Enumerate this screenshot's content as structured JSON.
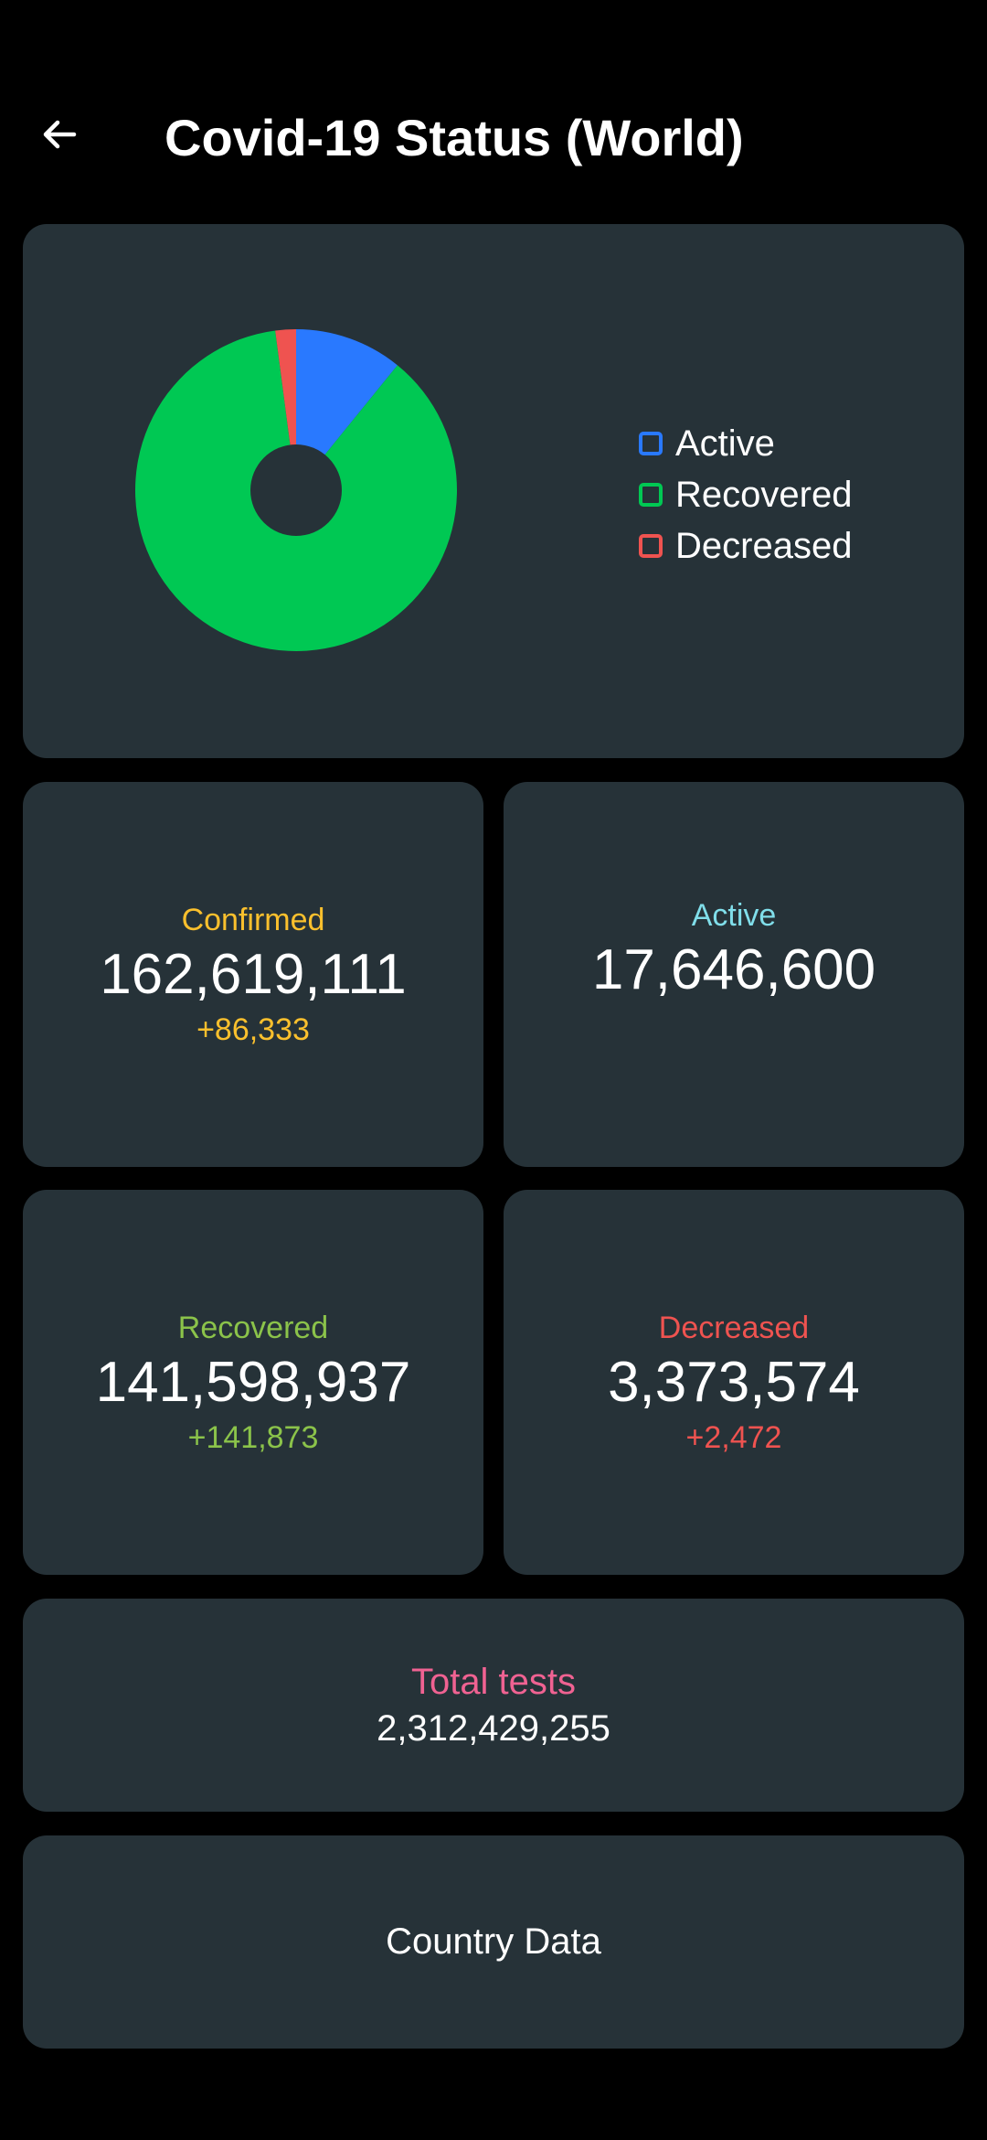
{
  "header": {
    "title": "Covid-19 Status (World)",
    "back_icon": "arrow-left-icon"
  },
  "chart_data": {
    "type": "pie",
    "donut": true,
    "slices": [
      {
        "label": "Active",
        "value": 17646600,
        "color": "#2979ff"
      },
      {
        "label": "Recovered",
        "value": 141598937,
        "color": "#00c853"
      },
      {
        "label": "Decreased",
        "value": 3373574,
        "color": "#ef5350"
      }
    ],
    "legend_placement": "right"
  },
  "legend": {
    "items": [
      {
        "label": "Active",
        "color": "#2979ff"
      },
      {
        "label": "Recovered",
        "color": "#00c853"
      },
      {
        "label": "Decreased",
        "color": "#ef5350"
      }
    ]
  },
  "stats": {
    "confirmed": {
      "label": "Confirmed",
      "value": "162,619,111",
      "delta": "+86,333",
      "color": "#fbc02d"
    },
    "active": {
      "label": "Active",
      "value": "17,646,600",
      "color": "#80deea"
    },
    "recovered": {
      "label": "Recovered",
      "value": "141,598,937",
      "delta": "+141,873",
      "color": "#8bc34a"
    },
    "decreased": {
      "label": "Decreased",
      "value": "3,373,574",
      "delta": "+2,472",
      "color": "#ef5350"
    }
  },
  "tests": {
    "label": "Total tests",
    "value": "2,312,429,255",
    "color": "#f06292"
  },
  "country_button": {
    "label": "Country Data"
  }
}
